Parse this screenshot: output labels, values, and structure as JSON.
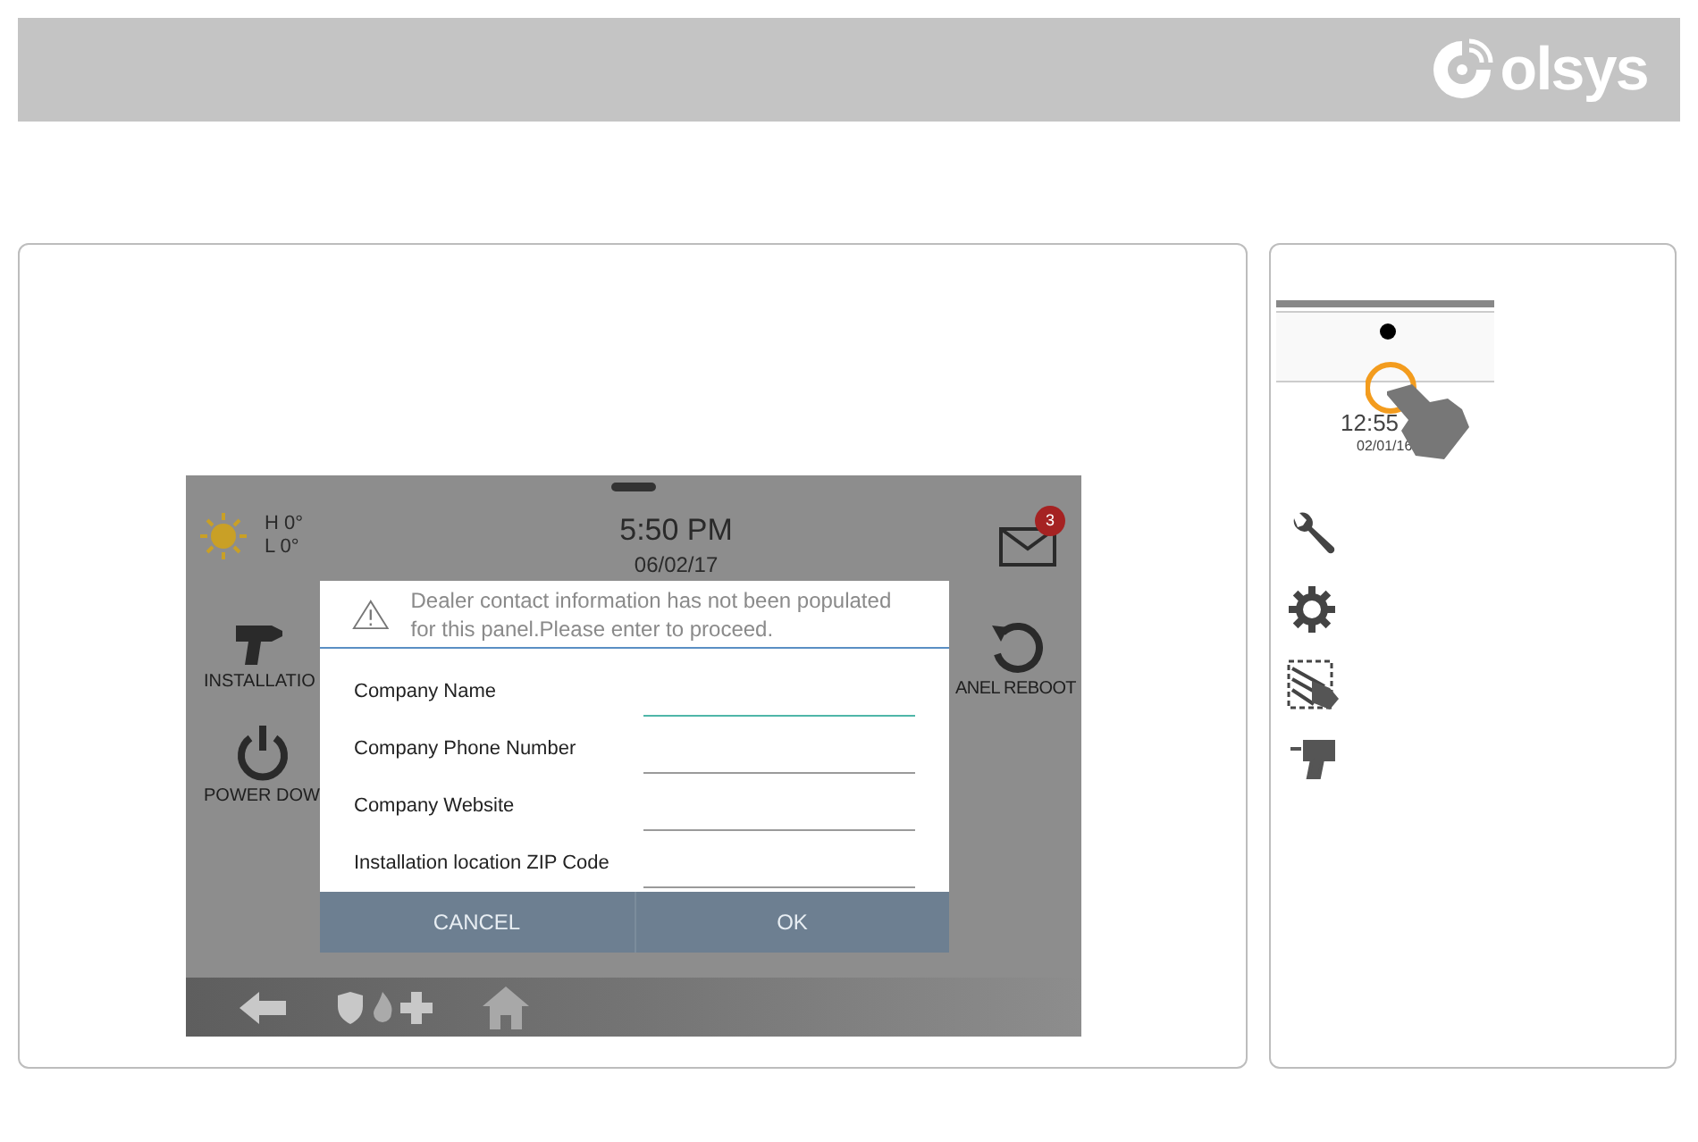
{
  "header": {
    "logo_text": "olsys"
  },
  "panel": {
    "weather": {
      "high": "H 0°",
      "low": "L 0°"
    },
    "time": "5:50 PM",
    "date": "06/02/17",
    "mail_badge": "3",
    "tiles": [
      {
        "kind": "installation",
        "label": "INSTALLATIO"
      },
      {
        "kind": "power",
        "label": "POWER DOW"
      },
      {
        "kind": "reboot",
        "label": "ANEL REBOOT"
      }
    ],
    "dialog": {
      "message": "Dealer contact information has not been populated for this panel.Please enter to proceed.",
      "fields": [
        {
          "label": "Company Name",
          "focused": true
        },
        {
          "label": "Company Phone Number",
          "focused": false
        },
        {
          "label": "Company Website",
          "focused": false
        },
        {
          "label": "Installation location ZIP Code",
          "focused": false
        }
      ],
      "buttons": [
        "CANCEL",
        "OK"
      ]
    }
  },
  "sidebar": {
    "time": "12:55",
    "date": "02/01/16"
  }
}
